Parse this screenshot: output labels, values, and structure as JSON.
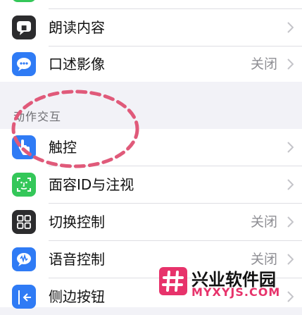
{
  "rows_top": [
    {
      "label": "朗读内容",
      "value": "",
      "icon": "speech-bubble-icon"
    },
    {
      "label": "口述影像",
      "value": "关闭",
      "icon": "audio-description-icon"
    }
  ],
  "section": {
    "header": "动作交互"
  },
  "rows_bottom": [
    {
      "label": "触控",
      "value": "",
      "icon": "hand-pointer-icon"
    },
    {
      "label": "面容ID与注视",
      "value": "",
      "icon": "face-id-icon"
    },
    {
      "label": "切换控制",
      "value": "关闭",
      "icon": "switch-grid-icon"
    },
    {
      "label": "语音控制",
      "value": "关闭",
      "icon": "voice-control-icon"
    },
    {
      "label": "侧边按钮",
      "value": "",
      "icon": "side-button-icon"
    }
  ],
  "watermark": {
    "title": "兴业软件园",
    "url": "MYXYJS.COM",
    "logo": "hash-logo-icon"
  },
  "colors": {
    "accent": "#2f7bf5",
    "green": "#34c759",
    "gray": "#8e8e93",
    "annotation": "#e05a7a"
  }
}
